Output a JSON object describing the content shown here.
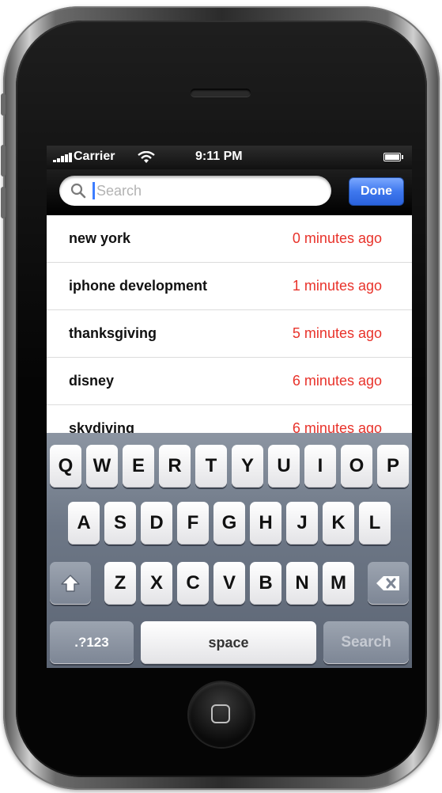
{
  "status_bar": {
    "carrier": "Carrier",
    "time": "9:11 PM"
  },
  "search": {
    "placeholder": "Search",
    "value": "",
    "done_label": "Done"
  },
  "results": [
    {
      "term": "new york",
      "time": "0 minutes ago"
    },
    {
      "term": "iphone development",
      "time": "1 minutes ago"
    },
    {
      "term": "thanksgiving",
      "time": "5 minutes ago"
    },
    {
      "term": "disney",
      "time": "6 minutes ago"
    },
    {
      "term": "skydiving",
      "time": "6 minutes ago"
    }
  ],
  "keyboard": {
    "row1": [
      "Q",
      "W",
      "E",
      "R",
      "T",
      "Y",
      "U",
      "I",
      "O",
      "P"
    ],
    "row2": [
      "A",
      "S",
      "D",
      "F",
      "G",
      "H",
      "J",
      "K",
      "L"
    ],
    "row3": [
      "Z",
      "X",
      "C",
      "V",
      "B",
      "N",
      "M"
    ],
    "numbers_label": ".?123",
    "space_label": "space",
    "search_label": "Search"
  },
  "colors": {
    "time_text": "#e8322a",
    "done_button": "#3f78ee",
    "cursor": "#3d7dff"
  }
}
